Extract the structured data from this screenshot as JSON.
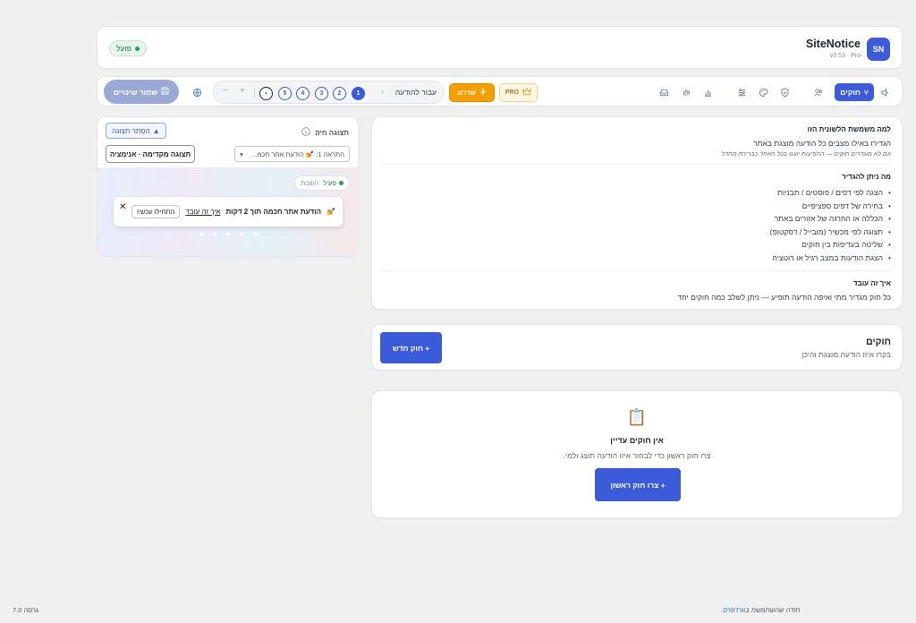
{
  "header": {
    "logo": "SN",
    "title": "SiteNotice",
    "version": "v3.53 · Pro",
    "status": "פועל"
  },
  "toolbar": {
    "rules_tab": "חוקים",
    "pro_badge": "PRO",
    "upgrade": "שדרוג",
    "jump_label": "עבור להודעה",
    "pages": [
      "1",
      "2",
      "3",
      "4",
      "5"
    ],
    "active_page": "1",
    "save": "שמור שינויים",
    "icons": [
      "speaker-icon",
      "users-icon",
      "shield-icon",
      "palette-icon",
      "sliders-icon",
      "chart-icon",
      "fingerprint-icon",
      "inbox-icon",
      "globe-icon"
    ]
  },
  "explain": {
    "why_title": "למה משמשת הלשונית הזו",
    "why_text": "הגדירו באילו מצבים כל הודעה מוצגת באתר",
    "why_note": "אם לא מוגדרים חוקים — ההודעות יוצגו בכל האתר כברירת מחדל",
    "what_title": "מה ניתן להגדיר",
    "features": [
      "הצגה לפי דפים / פוסטים / תבניות",
      "בחירה של דפים ספציפיים",
      "הכללה או החרגה של אזורים באתר",
      "תצוגה לפי מכשיר (מובייל / דסקטופ)",
      "שליטה בעדיפות בין חוקים",
      "הצגת הודעות במצב רגיל או רוטציה"
    ],
    "how_title": "איך זה עובד",
    "how_text": "כל חוק מגדיר מתי ואיפה הודעה תופיע — ניתן לשלב כמה חוקים יחד"
  },
  "rules": {
    "title": "חוקים",
    "subtitle": "בקרו איזו הודעה מוצגת והיכן",
    "new_rule": "+ חוק חדש"
  },
  "empty": {
    "icon": "📋",
    "title": "אין חוקים עדיין",
    "subtitle": "צרו חוק ראשון כדי לבחור איזו הודעה תוצג ולמי.",
    "create": "+ צרו חוק ראשון"
  },
  "preview": {
    "title": "תצוגה חיה",
    "hide": "הסתר תצוגה",
    "select_value": "התראה 1: 💅 הודעת אתר חכמ...",
    "anim": "תצוגה מקדימה · אנימציה",
    "toggle_on": "פעיל",
    "toggle_off": "השבת",
    "notice_icon": "💅",
    "notice_msg": "הודעת אתר חכמה תוך 2 דקות",
    "notice_link": "איך זה עובד",
    "notice_cta": "התחילו עכשיו"
  },
  "footer": {
    "thanks_prefix": "תודה שהשתמשת ב",
    "thanks_link": "וורדפרס",
    "thanks_suffix": ".",
    "version": "גרסה 7.0"
  },
  "colors": {
    "primary": "#3b5bdb",
    "upgrade": "#f59f00",
    "success": "#22a355"
  }
}
